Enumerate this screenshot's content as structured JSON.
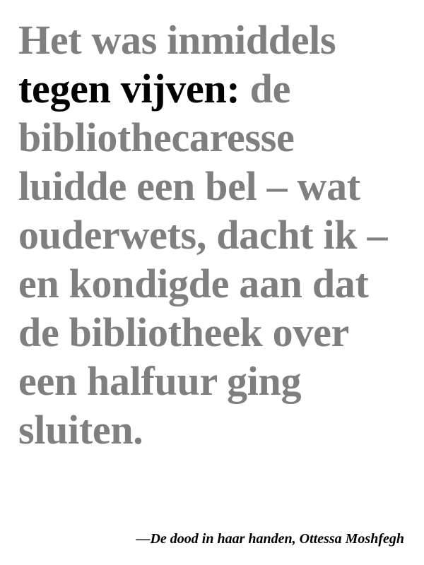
{
  "quote": {
    "lead": "Het was inmiddels",
    "emphasis": "tegen vijven:",
    "rest": "de bibliothecaresse luidde een bel – wat ouderwets, dacht ik – en kondigde aan dat de bibliotheek over een halfuur ging sluiten."
  },
  "attribution": "—De dood in haar handen, Ottessa Moshfegh",
  "colors": {
    "background": "#ffffff",
    "muted_text": "#7f7f7f",
    "emphasis_text": "#000000"
  }
}
